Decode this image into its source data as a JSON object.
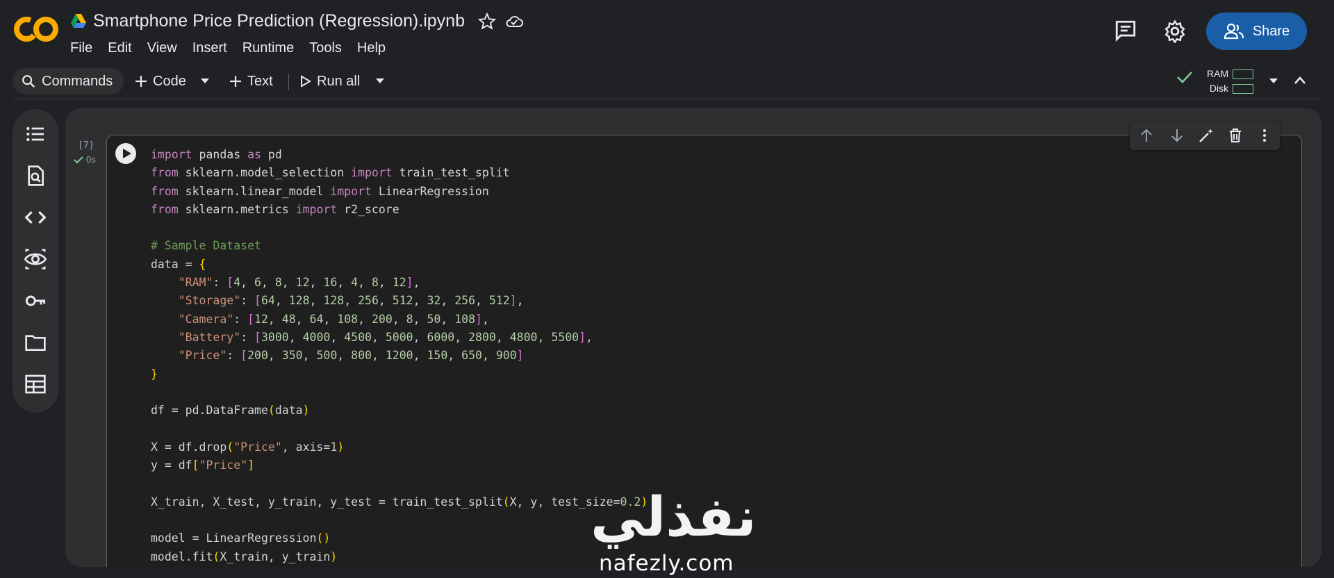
{
  "header": {
    "logo": "CO",
    "title": "Smartphone Price Prediction (Regression).ipynb",
    "menu": [
      "File",
      "Edit",
      "View",
      "Insert",
      "Runtime",
      "Tools",
      "Help"
    ],
    "share_label": "Share"
  },
  "toolbar": {
    "commands_label": "Commands",
    "code_label": "Code",
    "text_label": "Text",
    "run_all_label": "Run all",
    "ram_label": "RAM",
    "disk_label": "Disk"
  },
  "cell": {
    "execution_count": "[7]",
    "exec_time": "0s"
  },
  "watermark": {
    "arabic": "نفذلي",
    "site": "nafezly.com"
  },
  "colors": {
    "background": "#202124",
    "panel": "#2d2f31",
    "accent": "#1a5ea8",
    "keyword": "#c586c0",
    "string": "#ce9178",
    "number": "#b5cea8",
    "comment": "#6a9955"
  },
  "icons": [
    "colab-logo",
    "drive-icon",
    "star-icon",
    "cloud-icon",
    "comments-icon",
    "gear-icon",
    "people-icon",
    "search-icon",
    "plus-icon",
    "play-icon",
    "chevron-down-icon",
    "check-icon",
    "chevron-up-icon",
    "toc-icon",
    "find-icon",
    "code-icon",
    "variables-icon",
    "key-icon",
    "folder-icon",
    "table-icon",
    "arrow-up-icon",
    "arrow-down-icon",
    "edit-sparkle-icon",
    "trash-icon",
    "more-vert-icon"
  ]
}
